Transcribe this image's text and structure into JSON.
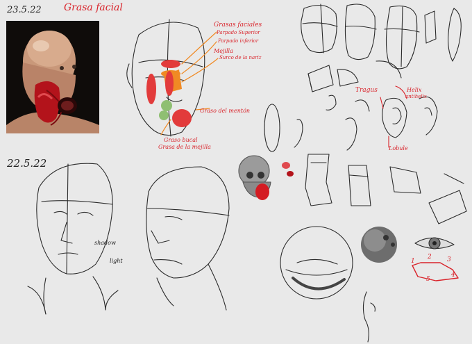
{
  "canvas": {
    "background": "#e9e9e9"
  },
  "colors": {
    "ink": "#2b2b2b",
    "red_text": "#d9232a",
    "fat_red": "#e23b3b",
    "fat_orange": "#f08a24",
    "fat_green": "#8fbf72",
    "eye_grey": "#777777"
  },
  "dates": {
    "top": "23.5.22",
    "middle": "22.5.22"
  },
  "titles": {
    "main": "Grasa facial"
  },
  "labels": {
    "grasas_faciales": "Grasas faciales",
    "parpado_superior": "Parpado Superior",
    "parpado_inferior": "Parpado inferior",
    "mejilla": "Mejilla",
    "surco_nariz": "Surco de la nariz",
    "graso_del_mentón": "Graso del mentón",
    "graso_bucal": "Graso bucal",
    "grasa_mejilla": "Grasa de la mejilla",
    "tragus": "Tragus",
    "helix": "Helix",
    "antihelix": "antihelix",
    "lobule": "Lobule",
    "shadow": "shadow",
    "light": "light"
  },
  "numbers": [
    "1",
    "2",
    "3",
    "4",
    "5"
  ]
}
